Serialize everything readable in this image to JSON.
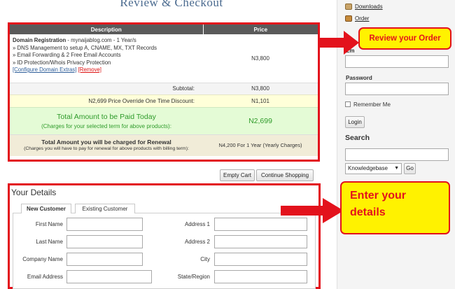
{
  "header": {
    "title": "Review & Checkout"
  },
  "order": {
    "col_description": "Description",
    "col_price": "Price",
    "item_title": "Domain Registration",
    "item_domain": " - mynaijablog.com - 1 Year/s",
    "features": [
      "» DNS Management to setup A, CNAME, MX, TXT Records",
      "» Email Forwarding & 2 Free Email Accounts",
      "» ID Protection/Whois Privacy Protection"
    ],
    "configure_link": "[Configure Domain Extras]",
    "remove_link": "[Remove]",
    "item_price": "N3,800",
    "subtotal_label": "Subtotal:",
    "subtotal_value": "N3,800",
    "override_label": "N2,699 Price Override One Time Discount:",
    "override_value": "N1,101",
    "total_title": "Total Amount to be Paid Today",
    "total_sub": "(Charges for your selected term for above products):",
    "total_value": "N2,699",
    "renew_title": "Total Amount you will be charged for Renewal",
    "renew_sub": "(Charges you will have to pay for renewal for above products with billing term):",
    "renew_value": "N4,200 For 1 Year (Yearly Charges)"
  },
  "actions": {
    "empty_cart": "Empty Cart",
    "continue_shopping": "Continue Shopping"
  },
  "callouts": {
    "review": "Review your Order",
    "details": "Enter your details"
  },
  "sidebar": {
    "downloads": "Downloads",
    "order": "Order",
    "email_label": "Em",
    "password_label": "Password",
    "remember_label": "Remember Me",
    "login_button": "Login",
    "search_heading": "Search",
    "search_select": "Knowledgebase",
    "go_button": "Go"
  },
  "details": {
    "heading": "Your Details",
    "tab_new": "New Customer",
    "tab_existing": "Existing Customer",
    "left_fields": [
      "First Name",
      "Last Name",
      "Company Name",
      "Email Address"
    ],
    "right_fields": [
      "Address 1",
      "Address 2",
      "City",
      "State/Region"
    ]
  },
  "colors": {
    "highlight_red": "#e3121c",
    "callout_yellow": "#fff200",
    "total_green": "#2e9b2a"
  }
}
